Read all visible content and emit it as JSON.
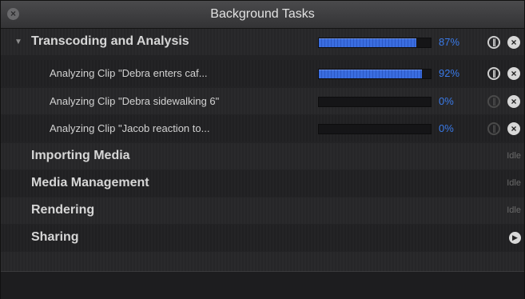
{
  "window": {
    "title": "Background Tasks",
    "close_glyph": "×"
  },
  "groups": [
    {
      "label": "Transcoding and Analysis",
      "expanded": true,
      "progress": 0.87,
      "percent": "87%",
      "tasks": [
        {
          "label": "Analyzing Clip \"Debra enters caf...",
          "progress": 0.92,
          "percent": "92%",
          "pause_enabled": true
        },
        {
          "label": "Analyzing Clip \"Debra sidewalking 6\"",
          "progress": 0.0,
          "percent": "0%",
          "pause_enabled": false
        },
        {
          "label": "Analyzing Clip \"Jacob reaction to...",
          "progress": 0.0,
          "percent": "0%",
          "pause_enabled": false
        }
      ]
    },
    {
      "label": "Importing Media",
      "status": "Idle"
    },
    {
      "label": "Media Management",
      "status": "Idle"
    },
    {
      "label": "Rendering",
      "status": "Idle"
    },
    {
      "label": "Sharing",
      "status_icon": "chevron-right-icon"
    }
  ],
  "colors": {
    "accent": "#3a7bea",
    "progress_fill": "#3a6de0"
  }
}
